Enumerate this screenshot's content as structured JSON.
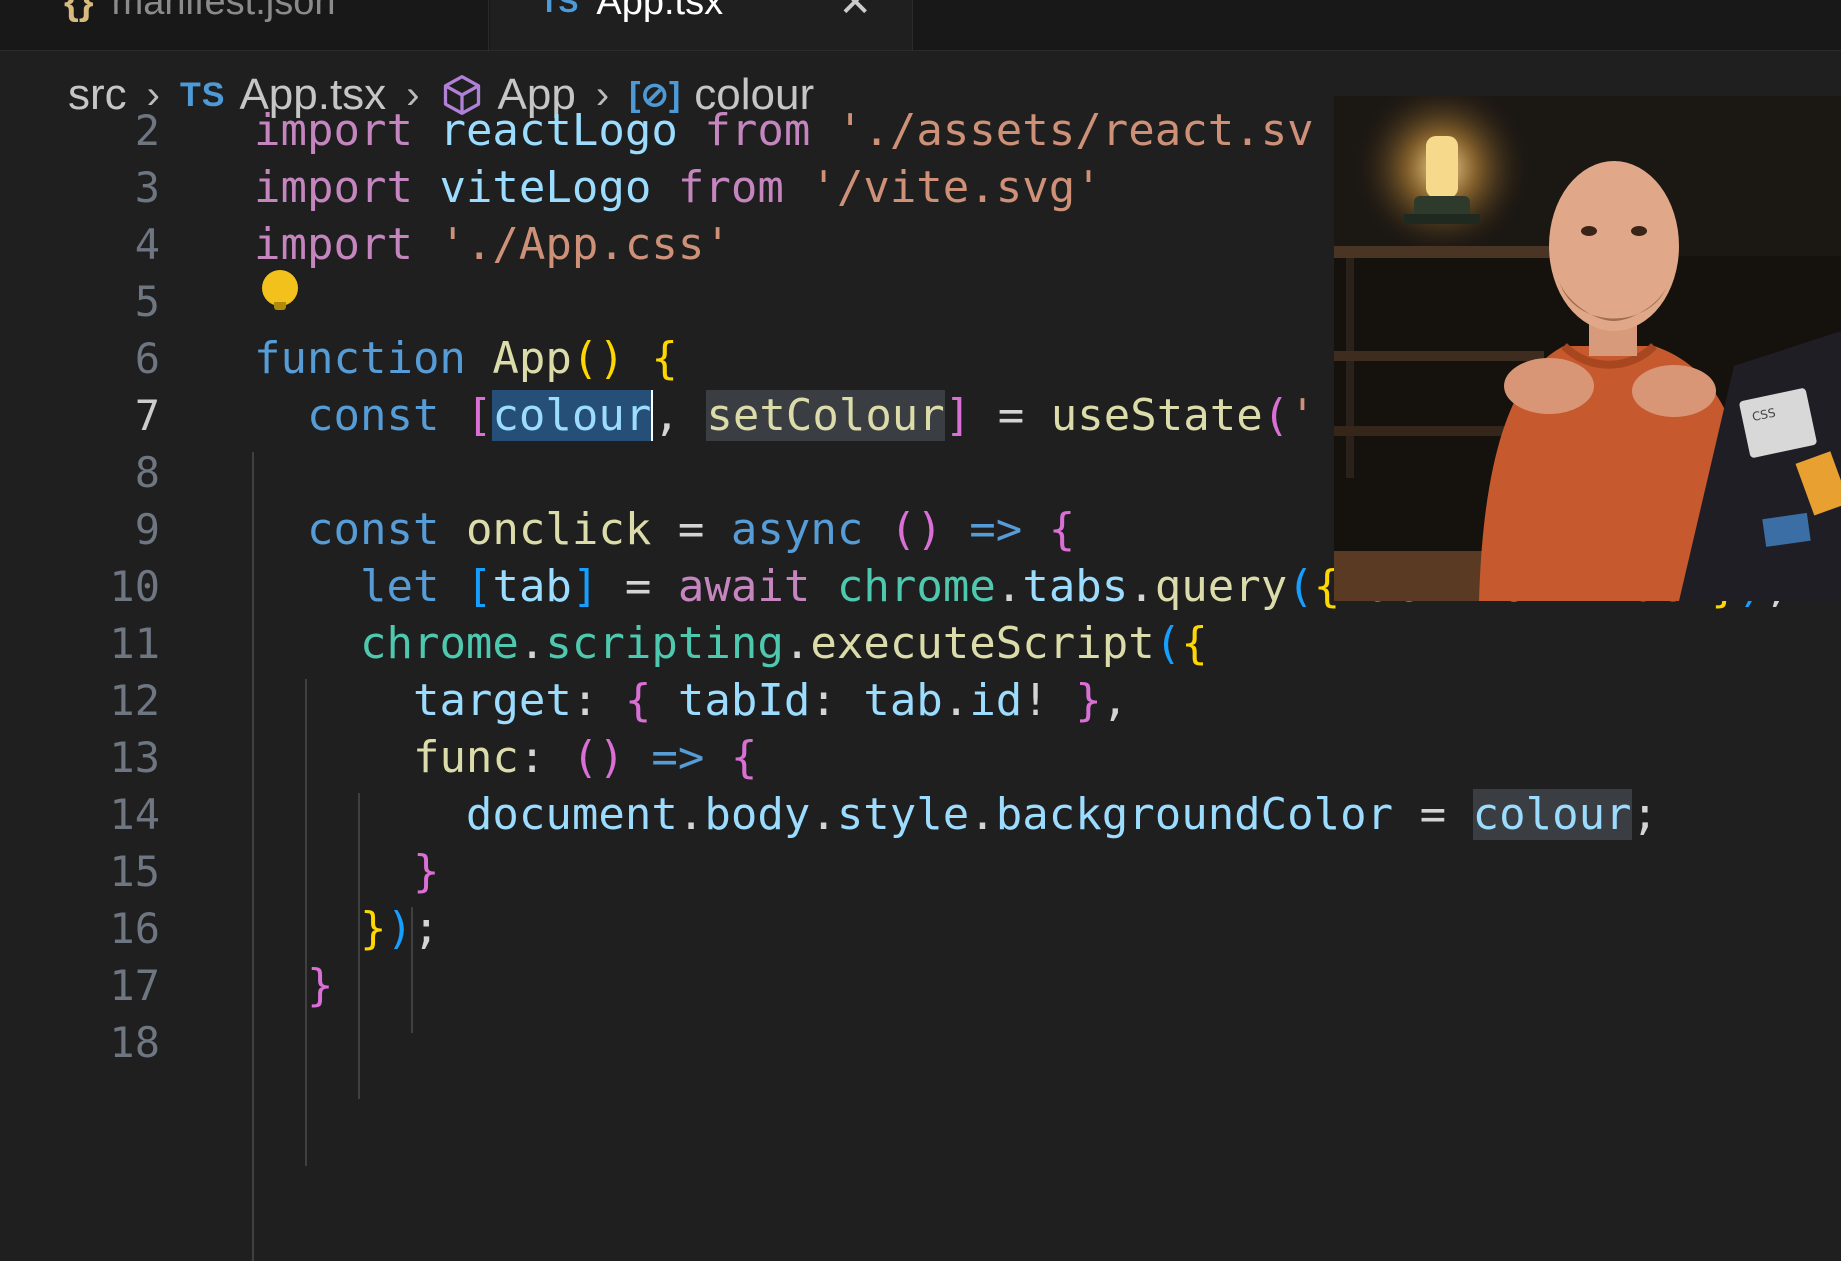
{
  "tabs": [
    {
      "label": "manifest.json",
      "icon": "{}",
      "active": false
    },
    {
      "label": "App.tsx",
      "icon": "TS",
      "active": true
    }
  ],
  "breadcrumb": {
    "folder": "src",
    "file": "App.tsx",
    "file_icon": "TS",
    "component": "App",
    "symbol": "colour"
  },
  "line_numbers": [
    "2",
    "3",
    "4",
    "5",
    "6",
    "7",
    "8",
    "9",
    "10",
    "11",
    "12",
    "13",
    "14",
    "15",
    "16",
    "17",
    "18"
  ],
  "current_line": "7",
  "code_lines": [
    [
      {
        "t": "import",
        "c": "kw-ctrl"
      },
      {
        "t": " "
      },
      {
        "t": "reactLogo",
        "c": "var"
      },
      {
        "t": " "
      },
      {
        "t": "from",
        "c": "kw-ctrl"
      },
      {
        "t": " "
      },
      {
        "t": "'./assets/react.sv",
        "c": "str"
      }
    ],
    [
      {
        "t": "import",
        "c": "kw-ctrl"
      },
      {
        "t": " "
      },
      {
        "t": "viteLogo",
        "c": "var"
      },
      {
        "t": " "
      },
      {
        "t": "from",
        "c": "kw-ctrl"
      },
      {
        "t": " "
      },
      {
        "t": "'/vite.svg'",
        "c": "str"
      }
    ],
    [
      {
        "t": "import",
        "c": "kw-ctrl"
      },
      {
        "t": " "
      },
      {
        "t": "'./App.css'",
        "c": "str"
      }
    ],
    [],
    [
      {
        "t": "function",
        "c": "kw"
      },
      {
        "t": " "
      },
      {
        "t": "App",
        "c": "fn"
      },
      {
        "t": "()",
        "c": "b1"
      },
      {
        "t": " "
      },
      {
        "t": "{",
        "c": "b1"
      }
    ],
    [
      {
        "t": "  "
      },
      {
        "t": "const",
        "c": "kw"
      },
      {
        "t": " "
      },
      {
        "t": "[",
        "c": "b2"
      },
      {
        "t": "colour",
        "c": "var hl caret"
      },
      {
        "t": ", "
      },
      {
        "t": "setColour",
        "c": "fn hl2"
      },
      {
        "t": "]",
        "c": "b2"
      },
      {
        "t": " = "
      },
      {
        "t": "useState",
        "c": "fn"
      },
      {
        "t": "(",
        "c": "b2"
      },
      {
        "t": "'",
        "c": "str"
      }
    ],
    [],
    [
      {
        "t": "  "
      },
      {
        "t": "const",
        "c": "kw"
      },
      {
        "t": " "
      },
      {
        "t": "onclick",
        "c": "fn"
      },
      {
        "t": " = "
      },
      {
        "t": "async",
        "c": "kw"
      },
      {
        "t": " "
      },
      {
        "t": "()",
        "c": "b2"
      },
      {
        "t": " "
      },
      {
        "t": "=>",
        "c": "kw"
      },
      {
        "t": " "
      },
      {
        "t": "{",
        "c": "b2"
      }
    ],
    [
      {
        "t": "    "
      },
      {
        "t": "let",
        "c": "kw"
      },
      {
        "t": " "
      },
      {
        "t": "[",
        "c": "b3"
      },
      {
        "t": "tab",
        "c": "var"
      },
      {
        "t": "]",
        "c": "b3"
      },
      {
        "t": " = "
      },
      {
        "t": "await",
        "c": "kw-ctrl"
      },
      {
        "t": " "
      },
      {
        "t": "chrome",
        "c": "ty"
      },
      {
        "t": "."
      },
      {
        "t": "tabs",
        "c": "var"
      },
      {
        "t": "."
      },
      {
        "t": "query",
        "c": "fn"
      },
      {
        "t": "(",
        "c": "b3"
      },
      {
        "t": "{",
        "c": "b1"
      },
      {
        "t": " "
      },
      {
        "t": "active",
        "c": "var"
      },
      {
        "t": ": "
      },
      {
        "t": "true",
        "c": "kw"
      },
      {
        "t": " "
      },
      {
        "t": "}",
        "c": "b1"
      },
      {
        "t": ")",
        "c": "b3"
      },
      {
        "t": ";"
      }
    ],
    [
      {
        "t": "    "
      },
      {
        "t": "chrome",
        "c": "ty"
      },
      {
        "t": "."
      },
      {
        "t": "scripting",
        "c": "ty"
      },
      {
        "t": "."
      },
      {
        "t": "executeScript",
        "c": "fn"
      },
      {
        "t": "(",
        "c": "b3"
      },
      {
        "t": "{",
        "c": "b1"
      }
    ],
    [
      {
        "t": "      "
      },
      {
        "t": "target",
        "c": "var"
      },
      {
        "t": ": "
      },
      {
        "t": "{",
        "c": "b2"
      },
      {
        "t": " "
      },
      {
        "t": "tabId",
        "c": "var"
      },
      {
        "t": ": "
      },
      {
        "t": "tab",
        "c": "var"
      },
      {
        "t": "."
      },
      {
        "t": "id",
        "c": "var"
      },
      {
        "t": "! "
      },
      {
        "t": "}",
        "c": "b2"
      },
      {
        "t": ","
      }
    ],
    [
      {
        "t": "      "
      },
      {
        "t": "func",
        "c": "fn"
      },
      {
        "t": ": "
      },
      {
        "t": "()",
        "c": "b2"
      },
      {
        "t": " "
      },
      {
        "t": "=>",
        "c": "kw"
      },
      {
        "t": " "
      },
      {
        "t": "{",
        "c": "b2"
      }
    ],
    [
      {
        "t": "        "
      },
      {
        "t": "document",
        "c": "var"
      },
      {
        "t": "."
      },
      {
        "t": "body",
        "c": "var"
      },
      {
        "t": "."
      },
      {
        "t": "style",
        "c": "var"
      },
      {
        "t": "."
      },
      {
        "t": "backgroundColor",
        "c": "var"
      },
      {
        "t": " = "
      },
      {
        "t": "colour",
        "c": "var hl2"
      },
      {
        "t": ";"
      }
    ],
    [
      {
        "t": "      "
      },
      {
        "t": "}",
        "c": "b2"
      }
    ],
    [
      {
        "t": "    "
      },
      {
        "t": "}",
        "c": "b1"
      },
      {
        "t": ")",
        "c": "b3"
      },
      {
        "t": ";"
      }
    ],
    [
      {
        "t": "  "
      },
      {
        "t": "}",
        "c": "b2"
      }
    ],
    []
  ],
  "colors": {
    "editor_bg": "#1f1f1f",
    "keyword": "#569cd6",
    "control_keyword": "#c586c0",
    "variable": "#9cdcfe",
    "function": "#dcdcaa",
    "string": "#ce9178",
    "type": "#4ec9b0",
    "selection": "#264f78"
  },
  "icons": {
    "lightbulb": "lightbulb-icon",
    "component": "cube-icon",
    "variable": "variable-icon",
    "close": "close-icon",
    "chevron": "chevron-right-icon"
  }
}
